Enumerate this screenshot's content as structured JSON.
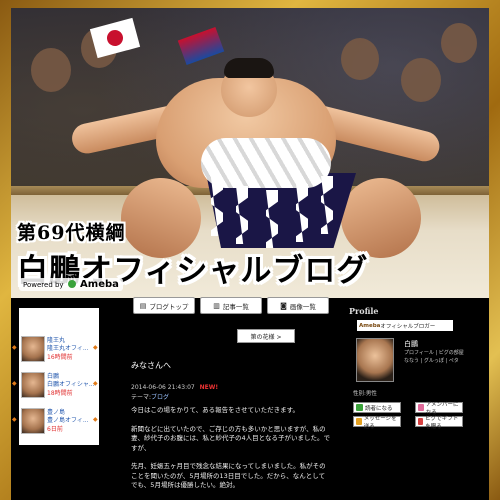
{
  "header": {
    "rank_title": "第69代横綱",
    "blog_title": "白鵬オフィシャルブログ",
    "powered_prefix": "Powered by",
    "powered_brand": "Ameba"
  },
  "nav": {
    "blog_top": "ブログトップ",
    "article_list": "記事一覧",
    "image_list": "画像一覧"
  },
  "theme_button": "第の花様 >",
  "post": {
    "title": "みなさんへ",
    "datetime": "2014-06-06 21:43:07",
    "new_badge": "NEW!",
    "theme_label": "テーマ:",
    "theme_value": "ブログ",
    "paragraphs": [
      "今日はこの場をかりて、ある報告をさせていただきます。",
      "新聞などに出ていたので、ご存じの方も多いかと思いますが、私の妻、紗代子のお腹には、私と紗代子の4人目となる子がいました。ですが、",
      "先月、妊娠五ヶ月目で残念な結果になってしまいました。私がそのことを聞いたのが、5月場所の13日目でした。だから、なんとしてでも、5月場所は優勝したい。絶対。"
    ]
  },
  "left_sidebar": {
    "items": [
      {
        "name1": "隆王丸",
        "name2": "隆王丸オフィ...",
        "status": "16時間前"
      },
      {
        "name1": "白鵬",
        "name2": "白鵬オフィシャ...",
        "status": "18時間前"
      },
      {
        "name1": "豊ノ島",
        "name2": "豊ノ島オフィ...",
        "status": "6日前"
      }
    ]
  },
  "right_sidebar": {
    "heading": "Profile",
    "bar_brand": "Ameba",
    "bar_text": "オフィシャルブロガー",
    "name": "白鵬",
    "links": "プロフィール | ピグの部屋",
    "links2": "ななう | グルっぽ | ペタ",
    "sex": "性別:男性",
    "buttons": {
      "reader": "読者になる",
      "amember": "アメンバーになる",
      "message": "メッセージを送る",
      "pigg_gift": "ピグでギフトを贈る"
    }
  },
  "colors": {
    "frame_gold": "#d4a52e",
    "page_bg": "#000000",
    "link_blue": "#2a5db0",
    "new_red": "#e33333"
  }
}
